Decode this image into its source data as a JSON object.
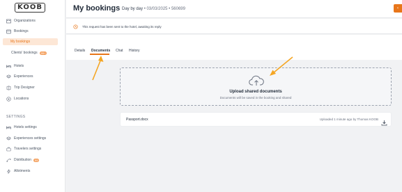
{
  "logo_text": "KOOB",
  "sidebar": {
    "items": [
      {
        "label": "Organizations",
        "icon": "organizations-icon"
      },
      {
        "label": "Bookings",
        "icon": "bookings-icon"
      },
      {
        "label": "My bookings",
        "active": true
      },
      {
        "label": "Clients' bookings",
        "badge": "99+"
      },
      {
        "label": "Hotels",
        "icon": "bed-icon"
      },
      {
        "label": "Experiences",
        "icon": "layers-icon"
      },
      {
        "label": "Trip Designer",
        "icon": "trip-icon"
      },
      {
        "label": "Locations",
        "icon": "location-icon"
      }
    ],
    "settings_title": "SETTINGS",
    "settings": [
      {
        "label": "Hotels settings",
        "icon": "bed-icon"
      },
      {
        "label": "Experiences settings",
        "icon": "layers-icon"
      },
      {
        "label": "Travelers settings",
        "icon": "travelers-icon"
      },
      {
        "label": "Distribution",
        "icon": "distribution-icon",
        "badge": "99"
      },
      {
        "label": "Allotments",
        "icon": "lightning-icon"
      }
    ]
  },
  "header": {
    "title": "My bookings",
    "mode": "Day by day",
    "date": "03/03/2025",
    "ref": "560699"
  },
  "notice": {
    "text": "This request has been sent to the hotel, awaiting its reply"
  },
  "tabs": [
    {
      "label": "Details"
    },
    {
      "label": "Documents",
      "active": true
    },
    {
      "label": "Chat"
    },
    {
      "label": "History"
    }
  ],
  "upload": {
    "title": "Upload shared documents",
    "subtitle": "Documents will be saved in the booking and shared"
  },
  "file": {
    "name": "Passport.docx",
    "meta": "Uploaded 1 minute ago by Thomas KOOB"
  },
  "colors": {
    "accent": "#e8761a",
    "active_bg": "#fde7d6",
    "arrow": "#f5a623"
  }
}
